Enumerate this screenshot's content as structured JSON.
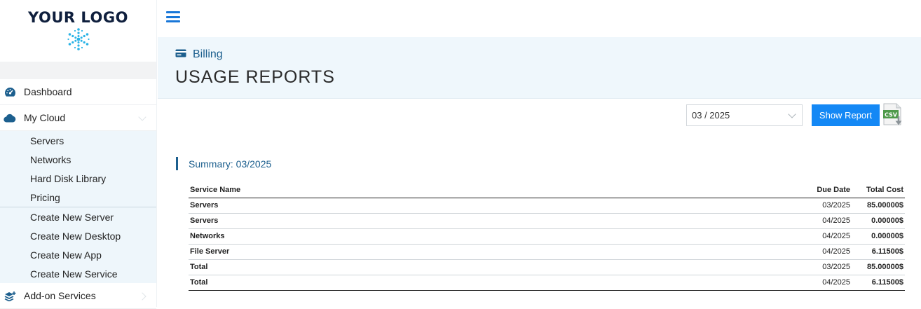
{
  "logo": {
    "text": "YOUR LOGO",
    "color": "#0f1f3d",
    "mark_color": "#29b3e6"
  },
  "sidebar": {
    "dashboard": {
      "label": "Dashboard",
      "icon": "speedometer-icon"
    },
    "my_cloud": {
      "label": "My Cloud",
      "icon": "cloud-icon",
      "items": [
        {
          "label": "Servers"
        },
        {
          "label": "Networks"
        },
        {
          "label": "Hard Disk Library"
        },
        {
          "label": "Pricing"
        }
      ],
      "create_items": [
        {
          "label": "Create New Server"
        },
        {
          "label": "Create New Desktop"
        },
        {
          "label": "Create New App"
        },
        {
          "label": "Create New Service"
        }
      ]
    },
    "addon": {
      "label": "Add-on Services",
      "icon": "layers-plus-icon"
    }
  },
  "header": {
    "breadcrumb": "Billing",
    "breadcrumb_icon": "credit-card-icon",
    "title": "USAGE REPORTS"
  },
  "controls": {
    "period_value": "03 / 2025",
    "show_report_label": "Show Report",
    "csv_icon": "csv-download-icon",
    "csv_label": "CSV"
  },
  "summary": {
    "label": "Summary: 03/2025"
  },
  "table": {
    "columns": [
      "Service Name",
      "Due Date",
      "Total Cost"
    ],
    "rows": [
      {
        "name": "Servers",
        "date": "03/2025",
        "cost": "85.00000$"
      },
      {
        "name": "Servers",
        "date": "04/2025",
        "cost": "0.00000$"
      },
      {
        "name": "Networks",
        "date": "04/2025",
        "cost": "0.00000$"
      },
      {
        "name": "File Server",
        "date": "04/2025",
        "cost": "6.11500$"
      }
    ],
    "totals": [
      {
        "name": "Total",
        "date": "03/2025",
        "cost": "85.00000$"
      },
      {
        "name": "Total",
        "date": "04/2025",
        "cost": "6.11500$"
      }
    ]
  },
  "colors": {
    "accent": "#1488f5",
    "brand_blue": "#1c5f8e",
    "header_bg": "#eff7fc",
    "submenu_bg": "#eef6fb"
  }
}
